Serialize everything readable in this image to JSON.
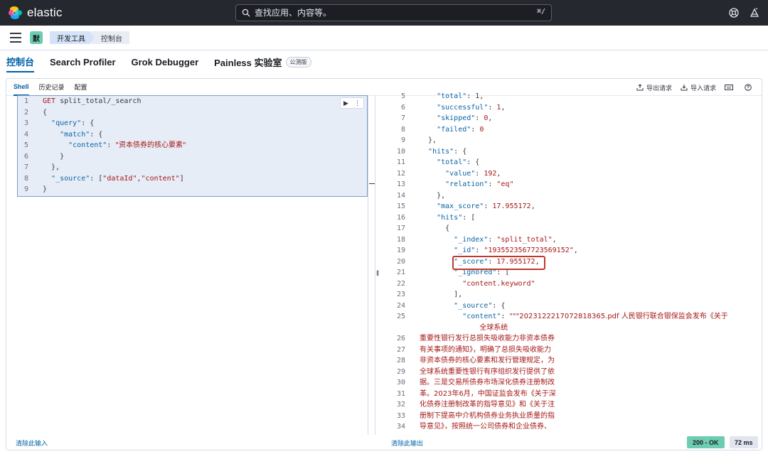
{
  "topbar": {
    "brand": "elastic",
    "search_placeholder": "查找应用、内容等。",
    "search_shortcut": "⌘/"
  },
  "breadcrumbs": {
    "space_initial": "默",
    "items": [
      "开发工具",
      "控制台"
    ]
  },
  "tabs": [
    "控制台",
    "Search Profiler",
    "Grok Debugger",
    "Painless 实验室"
  ],
  "beta_badge": "公测版",
  "subtabs": [
    "Shell",
    "历史记录",
    "配置"
  ],
  "actions": {
    "export": "导出请求",
    "import": "导入请求"
  },
  "request_lines": [
    {
      "n": "1",
      "parts": [
        [
          "method",
          "GET "
        ],
        [
          "url",
          "split_total/_search"
        ]
      ]
    },
    {
      "n": "2",
      "parts": [
        [
          "pun",
          "{"
        ]
      ]
    },
    {
      "n": "3",
      "parts": [
        [
          "pun",
          "  "
        ],
        [
          "key",
          "\"query\""
        ],
        [
          "pun",
          ": {"
        ]
      ]
    },
    {
      "n": "4",
      "parts": [
        [
          "pun",
          "    "
        ],
        [
          "key",
          "\"match\""
        ],
        [
          "pun",
          ": {"
        ]
      ]
    },
    {
      "n": "5",
      "parts": [
        [
          "pun",
          "      "
        ],
        [
          "key",
          "\"content\""
        ],
        [
          "pun",
          ": "
        ],
        [
          "str",
          "\"资本债券的核心要素\""
        ]
      ]
    },
    {
      "n": "6",
      "parts": [
        [
          "pun",
          "    }"
        ]
      ]
    },
    {
      "n": "7",
      "parts": [
        [
          "pun",
          "  },"
        ]
      ]
    },
    {
      "n": "8",
      "parts": [
        [
          "pun",
          "  "
        ],
        [
          "key",
          "\"_source\""
        ],
        [
          "pun",
          ": ["
        ],
        [
          "str",
          "\"dataId\""
        ],
        [
          "pun",
          ","
        ],
        [
          "str",
          "\"content\""
        ],
        [
          "pun",
          "]"
        ]
      ]
    },
    {
      "n": "9",
      "parts": [
        [
          "pun",
          "}"
        ]
      ]
    }
  ],
  "response_lines": [
    {
      "n": "5",
      "parts": [
        [
          "pun",
          "    "
        ],
        [
          "key",
          "\"total\""
        ],
        [
          "pun",
          ": 1,"
        ]
      ]
    },
    {
      "n": "6",
      "parts": [
        [
          "pun",
          "    "
        ],
        [
          "key",
          "\"successful\""
        ],
        [
          "pun",
          ": "
        ],
        [
          "num",
          "1"
        ],
        [
          "pun",
          ","
        ]
      ]
    },
    {
      "n": "7",
      "parts": [
        [
          "pun",
          "    "
        ],
        [
          "key",
          "\"skipped\""
        ],
        [
          "pun",
          ": "
        ],
        [
          "num",
          "0"
        ],
        [
          "pun",
          ","
        ]
      ]
    },
    {
      "n": "8",
      "parts": [
        [
          "pun",
          "    "
        ],
        [
          "key",
          "\"failed\""
        ],
        [
          "pun",
          ": "
        ],
        [
          "num",
          "0"
        ]
      ]
    },
    {
      "n": "9",
      "parts": [
        [
          "pun",
          "  },"
        ]
      ]
    },
    {
      "n": "10",
      "parts": [
        [
          "pun",
          "  "
        ],
        [
          "key",
          "\"hits\""
        ],
        [
          "pun",
          ": {"
        ]
      ]
    },
    {
      "n": "11",
      "parts": [
        [
          "pun",
          "    "
        ],
        [
          "key",
          "\"total\""
        ],
        [
          "pun",
          ": {"
        ]
      ]
    },
    {
      "n": "12",
      "parts": [
        [
          "pun",
          "      "
        ],
        [
          "key",
          "\"value\""
        ],
        [
          "pun",
          ": "
        ],
        [
          "num",
          "192"
        ],
        [
          "pun",
          ","
        ]
      ]
    },
    {
      "n": "13",
      "parts": [
        [
          "pun",
          "      "
        ],
        [
          "key",
          "\"relation\""
        ],
        [
          "pun",
          ": "
        ],
        [
          "str",
          "\"eq\""
        ]
      ]
    },
    {
      "n": "14",
      "parts": [
        [
          "pun",
          "    },"
        ]
      ]
    },
    {
      "n": "15",
      "parts": [
        [
          "pun",
          "    "
        ],
        [
          "key",
          "\"max_score\""
        ],
        [
          "pun",
          ": "
        ],
        [
          "num",
          "17.955172"
        ],
        [
          "pun",
          ","
        ]
      ]
    },
    {
      "n": "16",
      "parts": [
        [
          "pun",
          "    "
        ],
        [
          "key",
          "\"hits\""
        ],
        [
          "pun",
          ": ["
        ]
      ]
    },
    {
      "n": "17",
      "parts": [
        [
          "pun",
          "      {"
        ]
      ]
    },
    {
      "n": "18",
      "parts": [
        [
          "pun",
          "        "
        ],
        [
          "key",
          "\"_index\""
        ],
        [
          "pun",
          ": "
        ],
        [
          "str",
          "\"split_total\""
        ],
        [
          "pun",
          ","
        ]
      ]
    },
    {
      "n": "19",
      "parts": [
        [
          "pun",
          "        "
        ],
        [
          "key",
          "\"_id\""
        ],
        [
          "pun",
          ": "
        ],
        [
          "str",
          "\"1935523567723569152\""
        ],
        [
          "pun",
          ","
        ]
      ]
    },
    {
      "n": "20",
      "parts": [
        [
          "pun",
          "        "
        ],
        [
          "key",
          "\"_score\""
        ],
        [
          "pun",
          ": "
        ],
        [
          "num",
          "17.955172"
        ],
        [
          "pun",
          ","
        ]
      ]
    },
    {
      "n": "21",
      "parts": [
        [
          "pun",
          "        "
        ],
        [
          "key",
          "\"_ignored\""
        ],
        [
          "pun",
          ": ["
        ]
      ]
    },
    {
      "n": "22",
      "parts": [
        [
          "pun",
          "          "
        ],
        [
          "str",
          "\"content.keyword\""
        ]
      ]
    },
    {
      "n": "23",
      "parts": [
        [
          "pun",
          "        ],"
        ]
      ]
    },
    {
      "n": "24",
      "parts": [
        [
          "pun",
          "        "
        ],
        [
          "key",
          "\"_source\""
        ],
        [
          "pun",
          ": {"
        ]
      ]
    },
    {
      "n": "25",
      "parts": [
        [
          "pun",
          "          "
        ],
        [
          "key",
          "\"content\""
        ],
        [
          "pun",
          ": "
        ],
        [
          "str",
          "\"\"\"2023122217072818365.pdf 人民银行联合银保监会发布《关于"
        ]
      ]
    },
    {
      "n": "",
      "parts": [
        [
          "pun",
          "              "
        ],
        [
          "str",
          "全球系统"
        ]
      ]
    },
    {
      "n": "26",
      "parts": [
        [
          "str",
          "重要性银行发行总损失吸收能力非资本债券"
        ]
      ]
    },
    {
      "n": "27",
      "parts": [
        [
          "str",
          "有关事项的通知》，明确了总损失吸收能力"
        ]
      ]
    },
    {
      "n": "28",
      "parts": [
        [
          "str",
          "非资本债券的核心要素和发行管理规定，为"
        ]
      ]
    },
    {
      "n": "29",
      "parts": [
        [
          "str",
          "全球系统重要性银行有序组织发行提供了依"
        ]
      ]
    },
    {
      "n": "30",
      "parts": [
        [
          "str",
          "据。三是交易所债券市场深化债券注册制改"
        ]
      ]
    },
    {
      "n": "31",
      "parts": [
        [
          "str",
          "革。2023年6月，中国证监会发布《关于深"
        ]
      ]
    },
    {
      "n": "32",
      "parts": [
        [
          "str",
          "化债券注册制改革的指导意见》和《关于注"
        ]
      ]
    },
    {
      "n": "33",
      "parts": [
        [
          "str",
          "册制下提高中介机构债券业务执业质量的指"
        ]
      ]
    },
    {
      "n": "34",
      "parts": [
        [
          "str",
          "导意见》，按照统一公司债券和企业债券、"
        ]
      ]
    }
  ],
  "footer": {
    "clear_input": "清除此输入",
    "clear_output": "清除此输出",
    "status": "200 - OK",
    "time": "72 ms"
  }
}
